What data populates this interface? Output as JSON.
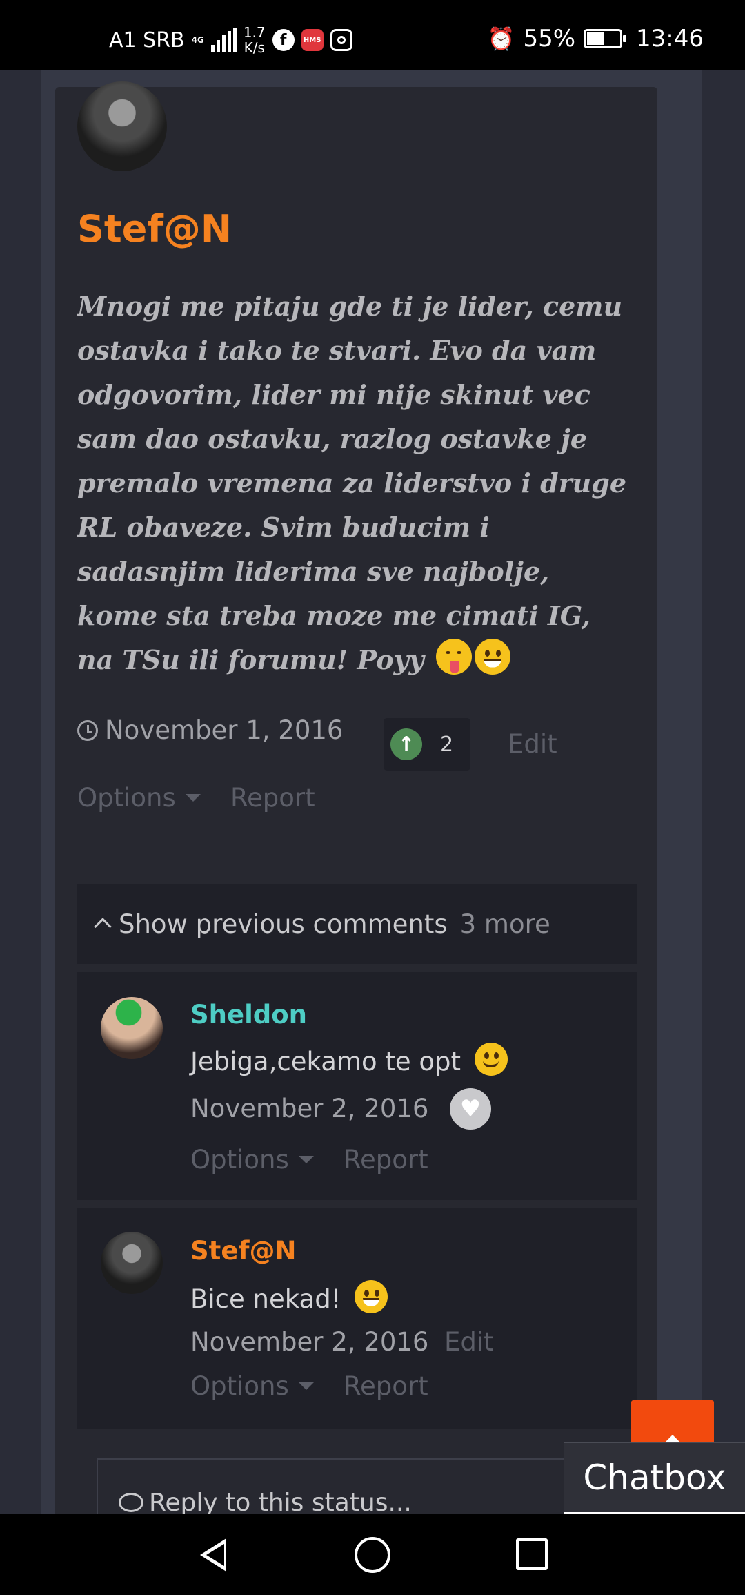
{
  "status_bar": {
    "carrier": "A1 SRB",
    "network": "4G",
    "speed_value": "1.7",
    "speed_unit": "K/s",
    "app_icons": [
      "facebook-icon",
      "hms-icon",
      "instagram-icon"
    ],
    "hms_label": "HMS",
    "battery_percent": "55%",
    "battery_level": 0.55,
    "time": "13:46"
  },
  "post": {
    "author": "Stef@N",
    "body": "Mnogi me pitaju gde ti je lider, cemu ostavka i tako te stvari. Evo da vam odgovorim, lider mi nije skinut vec sam dao ostavku, razlog ostavke je premalo vremena za liderstvo i druge RL obaveze. Svim buducim i sadasnjim liderima sve najbolje, kome sta treba moze me cimati IG, na TSu ili forumu! Poyy",
    "emojis": [
      "tongue-out-emoji",
      "grin-emoji"
    ],
    "date": "November 1, 2016",
    "reputation": "2",
    "edit_label": "Edit",
    "options_label": "Options",
    "report_label": "Report"
  },
  "comments_section": {
    "show_previous_label": "Show previous comments",
    "more_count": "3 more",
    "comments": [
      {
        "author": "Sheldon",
        "text": "Jebiga,cekamo te opt",
        "emoji": "smile-emoji",
        "date": "November 2, 2016",
        "options_label": "Options",
        "report_label": "Report"
      },
      {
        "author": "Stef@N",
        "text": "Bice nekad!",
        "emoji": "grin-emoji",
        "date": "November 2, 2016",
        "edit_label": "Edit",
        "options_label": "Options",
        "report_label": "Report"
      }
    ],
    "reply_placeholder": "Reply to this status..."
  },
  "chatbox_label": "Chatbox",
  "colors": {
    "accent_orange": "#f58220",
    "username_teal": "#4ecdc4",
    "background": "#2a2c37",
    "card": "#272830",
    "comment_bg": "#1f2028",
    "scroll_top_button": "#f24a0e",
    "reputation_green": "#4e8b54"
  }
}
